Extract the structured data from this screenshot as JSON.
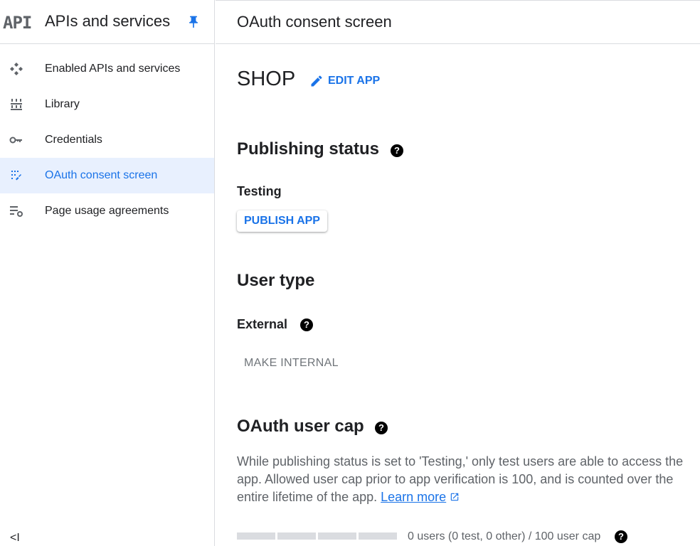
{
  "sidebar": {
    "logo_text": "API",
    "title": "APIs and services",
    "items": [
      {
        "label": "Enabled APIs and services",
        "icon": "api-diamond-icon"
      },
      {
        "label": "Library",
        "icon": "library-icon"
      },
      {
        "label": "Credentials",
        "icon": "key-icon"
      },
      {
        "label": "OAuth consent screen",
        "icon": "consent-icon"
      },
      {
        "label": "Page usage agreements",
        "icon": "settings-list-icon"
      }
    ],
    "collapse_label": "<I"
  },
  "header": {
    "title": "OAuth consent screen"
  },
  "app": {
    "name": "SHOP",
    "edit_label": "EDIT APP"
  },
  "publishing": {
    "heading": "Publishing status",
    "status": "Testing",
    "publish_label": "PUBLISH APP"
  },
  "user_type": {
    "heading": "User type",
    "value": "External",
    "make_internal_label": "MAKE INTERNAL"
  },
  "user_cap": {
    "heading": "OAuth user cap",
    "description": "While publishing status is set to 'Testing,' only test users are able to access the app. Allowed user cap prior to app verification is 100, and is counted over the entire lifetime of the app.",
    "learn_more": "Learn more",
    "cap_text": "0 users (0 test, 0 other) / 100 user cap",
    "progress": 0
  },
  "colors": {
    "accent": "#1a73e8",
    "active_bg": "#e8f0fe"
  }
}
